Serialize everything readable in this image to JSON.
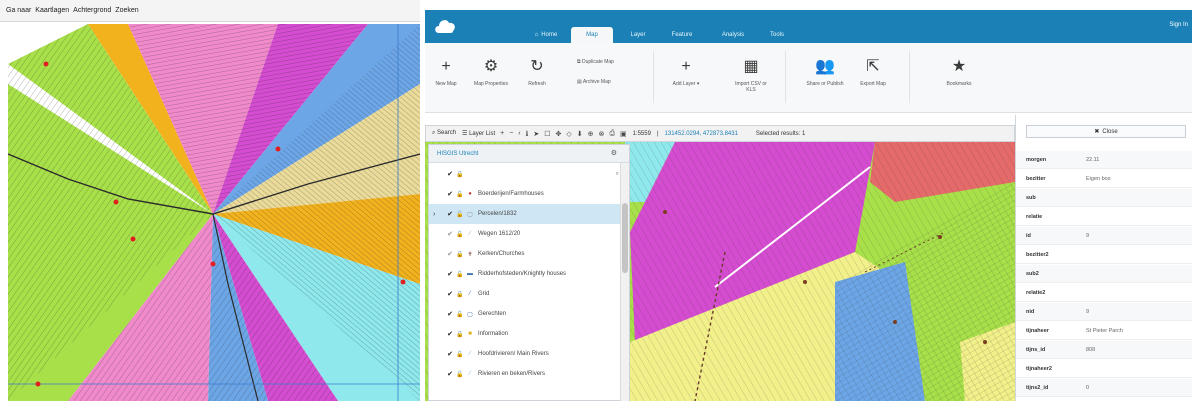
{
  "left": {
    "menu": [
      "Ga naar",
      "Kaartlagen",
      "Achtergrond",
      "Zoeken"
    ]
  },
  "app": {
    "nav_tabs": [
      "Home",
      "Map",
      "Layer",
      "Feature",
      "Analysis",
      "Tools"
    ],
    "active_tab": "Map",
    "signin": "Sign In",
    "ribbon": {
      "new_map": "New Map",
      "map_properties": "Map Properties",
      "refresh": "Refresh",
      "duplicate_map": "Duplicate Map",
      "archive_map": "Archive Map",
      "add_layer": "Add Layer",
      "import_csv": "Import CSV or KLS",
      "share_publish": "Share or Publish",
      "export_map": "Export Map",
      "bookmarks": "Bookmarks"
    },
    "toolbar": {
      "search": "Search",
      "layer_list": "Layer List",
      "scale": "1:5559",
      "coords": "131452.0294, 472873.8431",
      "selected": "Selected results: 1"
    },
    "layers": {
      "header": "HISGIS Utrecht",
      "items": [
        {
          "name": "",
          "checked": true
        },
        {
          "name": "Boerderijen/Farmhouses",
          "checked": true
        },
        {
          "name": "Percelen/1832",
          "checked": true,
          "selected": true
        },
        {
          "name": "Wegen 1612/20",
          "checked": true
        },
        {
          "name": "Kerken/Churches",
          "checked": true
        },
        {
          "name": "Ridderhofsteden/Knightly houses",
          "checked": true
        },
        {
          "name": "Grid",
          "checked": true
        },
        {
          "name": "Gerechten",
          "checked": true
        },
        {
          "name": "Information",
          "checked": true
        },
        {
          "name": "Hoofdrivieren/ Main Rivers",
          "checked": true
        },
        {
          "name": "Rivieren en beken/Rivers",
          "checked": true
        }
      ]
    },
    "attributes": {
      "close_label": "Close",
      "rows": [
        {
          "key": "morgen",
          "value": "22.11"
        },
        {
          "key": "bezitter",
          "value": "Eigen bos"
        },
        {
          "key": "sub",
          "value": ""
        },
        {
          "key": "relatie",
          "value": ""
        },
        {
          "key": "id",
          "value": "9"
        },
        {
          "key": "bezitter2",
          "value": ""
        },
        {
          "key": "sub2",
          "value": ""
        },
        {
          "key": "relatie2",
          "value": ""
        },
        {
          "key": "nid",
          "value": "9"
        },
        {
          "key": "tijnaheer",
          "value": "St Pieter Parch"
        },
        {
          "key": "tijns_id",
          "value": "808"
        },
        {
          "key": "tijnaheer2",
          "value": ""
        },
        {
          "key": "tijns2_id",
          "value": "0"
        }
      ]
    }
  },
  "colors": {
    "brand": "#1a80b6",
    "parcel_pink": "#f08acb",
    "parcel_magenta": "#d44ccf",
    "parcel_green": "#a8e04a",
    "parcel_yellow": "#f2f08a",
    "parcel_orange": "#f2b21e",
    "parcel_blue": "#6da6e6",
    "parcel_cyan": "#8ee8ec",
    "parcel_red": "#e56a6a",
    "parcel_tan": "#eadb9a"
  },
  "icons": [
    "home-icon",
    "plus-icon",
    "gear-icon",
    "refresh-icon",
    "copy-icon",
    "archive-icon",
    "grid-icon",
    "users-icon",
    "export-icon",
    "star-icon",
    "search-icon",
    "list-icon",
    "check-icon",
    "lock-icon"
  ]
}
